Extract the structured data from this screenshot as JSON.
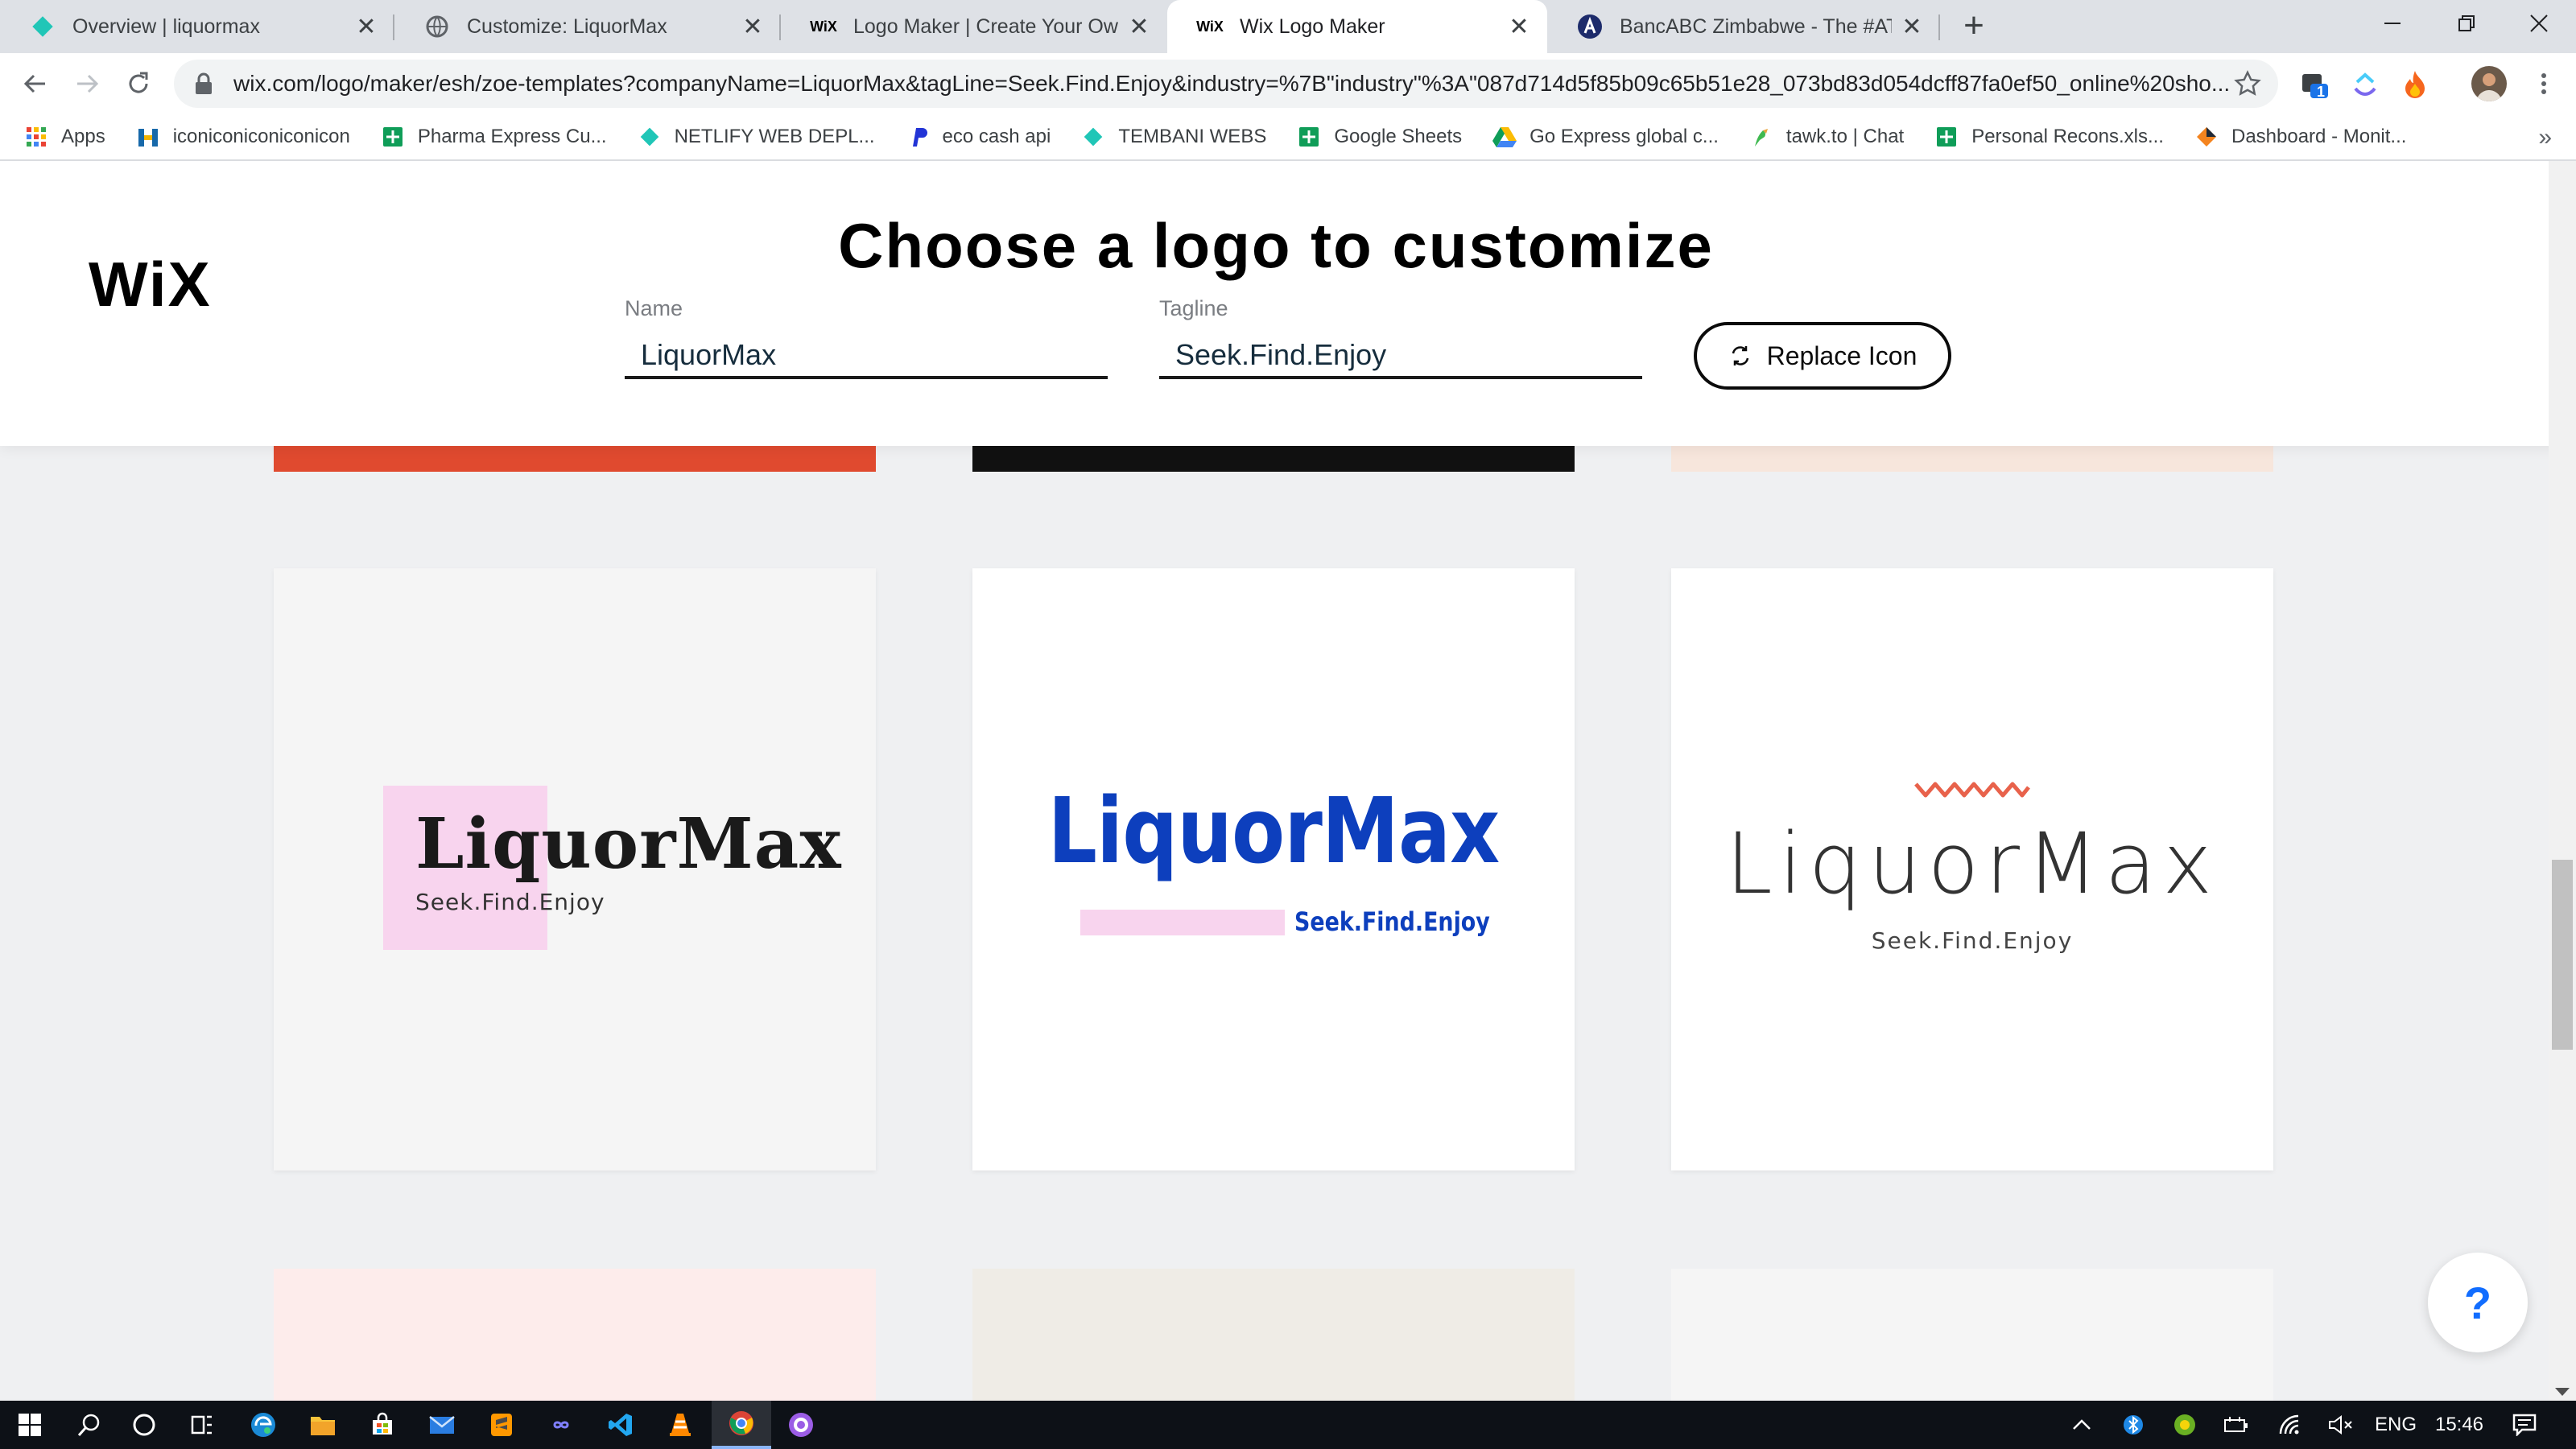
{
  "browser": {
    "tabs": [
      {
        "title": "Overview | liquormax",
        "icon": "netlify-diamond-icon",
        "active": false
      },
      {
        "title": "Customize: LiquorMax",
        "icon": "globe-icon",
        "active": false
      },
      {
        "title": "Logo Maker | Create Your Own Fr",
        "icon": "wix-icon",
        "active": false
      },
      {
        "title": "Wix Logo Maker",
        "icon": "wix-icon",
        "active": true
      },
      {
        "title": "BancABC Zimbabwe - The #ATea",
        "icon": "bancabc-icon",
        "active": false
      }
    ],
    "url": "wix.com/logo/maker/esh/zoe-templates?companyName=LiquorMax&tagLine=Seek.Find.Enjoy&industry=%7B\"industry\"%3A\"087d714d5f85b09c65b51e28_073bd83d054dcff87fa0ef50_online%20sho...",
    "extension_badge": "1",
    "bookmarks": [
      {
        "label": "Apps",
        "icon": "apps-grid-icon"
      },
      {
        "label": "iconiconiconiconicon",
        "icon": "iconify-icon"
      },
      {
        "label": "Pharma Express Cu...",
        "icon": "sheets-icon"
      },
      {
        "label": "NETLIFY WEB DEPL...",
        "icon": "netlify-diamond-icon"
      },
      {
        "label": "eco cash api",
        "icon": "paypal-icon"
      },
      {
        "label": "TEMBANI WEBS",
        "icon": "netlify-diamond-icon"
      },
      {
        "label": "Google Sheets",
        "icon": "sheets-icon"
      },
      {
        "label": "Go Express global c...",
        "icon": "drive-icon"
      },
      {
        "label": "tawk.to | Chat",
        "icon": "tawk-icon"
      },
      {
        "label": "Personal Recons.xls...",
        "icon": "sheets-icon"
      },
      {
        "label": "Dashboard - Monit...",
        "icon": "dashboard-icon"
      }
    ],
    "bookmarks_more": "»"
  },
  "page": {
    "brand": "WiX",
    "title": "Choose a logo to customize",
    "name_label": "Name",
    "name_value": "LiquorMax",
    "tagline_label": "Tagline",
    "tagline_value": "Seek.Find.Enjoy",
    "replace_button": "Replace Icon",
    "help": "?"
  },
  "logos": [
    {
      "name": "LiquorMax",
      "tagline": "Seek.Find.Enjoy",
      "background": "#f5f5f5",
      "accent": "#f8d4ee"
    },
    {
      "name": "LiquorMax",
      "tagline": "Seek.Find.Enjoy",
      "background": "#ffffff",
      "accent": "#0d3fbd"
    },
    {
      "name": "LiquorMax",
      "tagline": "Seek.Find.Enjoy",
      "background": "#ffffff",
      "accent": "#e8624b"
    }
  ],
  "taskbar": {
    "language": "ENG",
    "time": "15:46"
  },
  "colors": {
    "wix_blue": "#116dff",
    "card_top_red": "#e04a2f",
    "card_top_black": "#111111",
    "card_top_peach": "#f7e6dc"
  }
}
